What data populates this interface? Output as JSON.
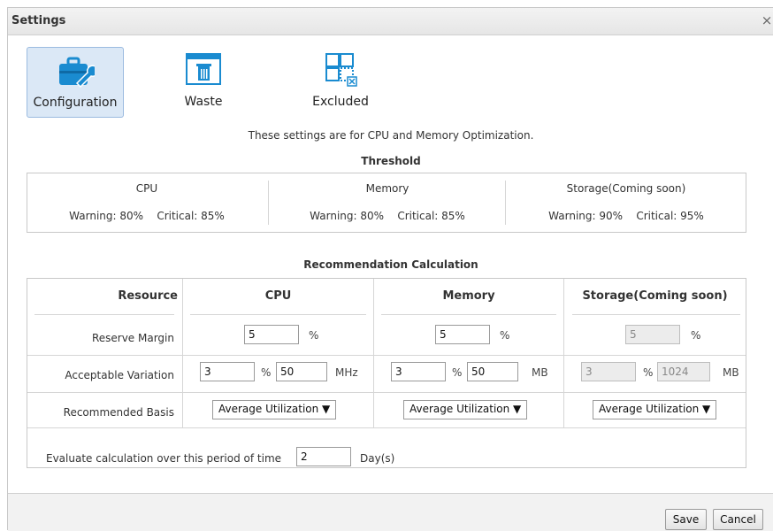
{
  "dialog": {
    "title": "Settings",
    "close_glyph": "×"
  },
  "tabs": [
    {
      "label": "Configuration",
      "icon": "toolbox-wrench-icon",
      "active": true
    },
    {
      "label": "Waste",
      "icon": "trash-window-icon",
      "active": false
    },
    {
      "label": "Excluded",
      "icon": "grid-excluded-icon",
      "active": false
    }
  ],
  "note": "These settings are for CPU and Memory Optimization.",
  "threshold": {
    "title": "Threshold",
    "columns": [
      {
        "name": "CPU",
        "warning": "Warning: 80%",
        "critical": "Critical: 85%"
      },
      {
        "name": "Memory",
        "warning": "Warning: 80%",
        "critical": "Critical: 85%"
      },
      {
        "name": "Storage(Coming soon)",
        "warning": "Warning: 90%",
        "critical": "Critical: 95%"
      }
    ]
  },
  "recommendation": {
    "title": "Recommendation Calculation",
    "headers": {
      "resource": "Resource",
      "cpu": "CPU",
      "memory": "Memory",
      "storage": "Storage(Coming soon)"
    },
    "rows": {
      "reserve_margin": "Reserve Margin",
      "acceptable_variation": "Acceptable Variation",
      "recommended_basis": "Recommended Basis"
    },
    "cpu": {
      "reserve": "5",
      "reserve_unit": "%",
      "variation_pct": "3",
      "pct_unit": "%",
      "variation_abs": "50",
      "abs_unit": "MHz",
      "basis": "Average Utilization ▼"
    },
    "memory": {
      "reserve": "5",
      "reserve_unit": "%",
      "variation_pct": "3",
      "pct_unit": "%",
      "variation_abs": "50",
      "abs_unit": "MB",
      "basis": "Average Utilization ▼"
    },
    "storage": {
      "reserve": "5",
      "reserve_unit": "%",
      "variation_pct": "3",
      "pct_unit": "%",
      "variation_abs": "1024",
      "abs_unit": "MB",
      "basis": "Average Utilization ▼"
    },
    "period": {
      "label": "Evaluate calculation over this period of time",
      "value": "2",
      "unit": "Day(s)"
    }
  },
  "buttons": {
    "save": "Save",
    "cancel": "Cancel"
  },
  "colors": {
    "accent": "#1a8bd0",
    "active_tab_bg": "#dbe8f6"
  }
}
